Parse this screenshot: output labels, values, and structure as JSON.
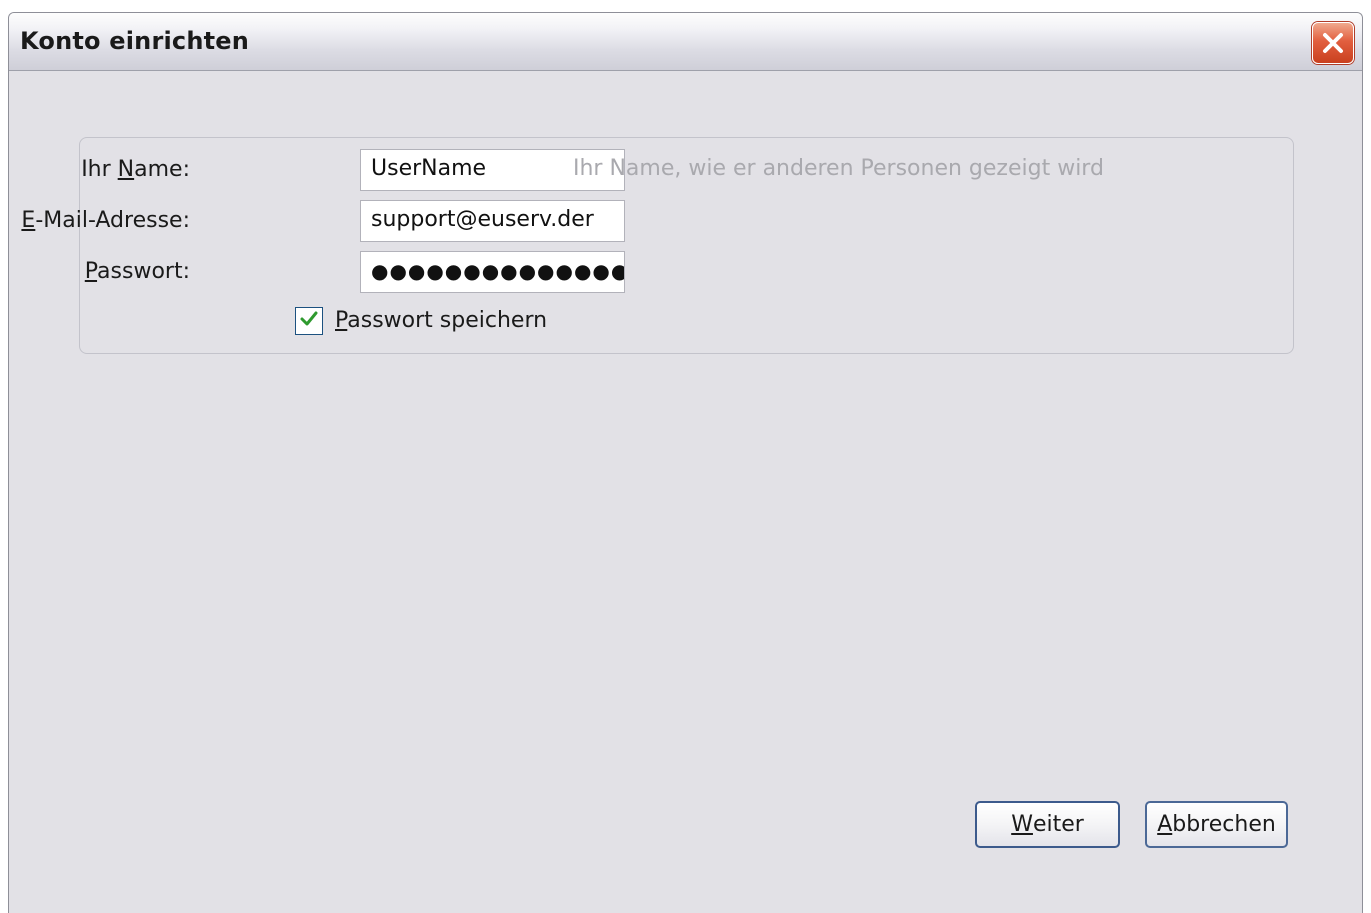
{
  "window": {
    "title": "Konto einrichten"
  },
  "form": {
    "name": {
      "label_accel": "N",
      "label_pre": "Ihr ",
      "label_post": "ame:",
      "value": "UserName",
      "hint": "Ihr Name, wie er anderen Personen gezeigt wird"
    },
    "email": {
      "label_accel": "E",
      "label_post": "-Mail-Adresse:",
      "value": "support@euserv.der"
    },
    "password": {
      "label_accel": "P",
      "label_post": "asswort:",
      "value_masked": "●●●●●●●●●●●●●●●"
    },
    "remember": {
      "checked": true,
      "label_accel": "P",
      "label_post": "asswort speichern"
    }
  },
  "buttons": {
    "next": {
      "accel": "W",
      "rest": "eiter"
    },
    "cancel": {
      "accel": "A",
      "rest": "bbrechen"
    }
  },
  "icons": {
    "close": "close-icon",
    "check": "check-icon"
  },
  "colors": {
    "dialog_bg": "#e2e1e6",
    "close_red": "#d9532f",
    "button_border": "#3c5a8c",
    "check_green": "#2f9a2f",
    "hint_gray": "#a9a9ae"
  }
}
